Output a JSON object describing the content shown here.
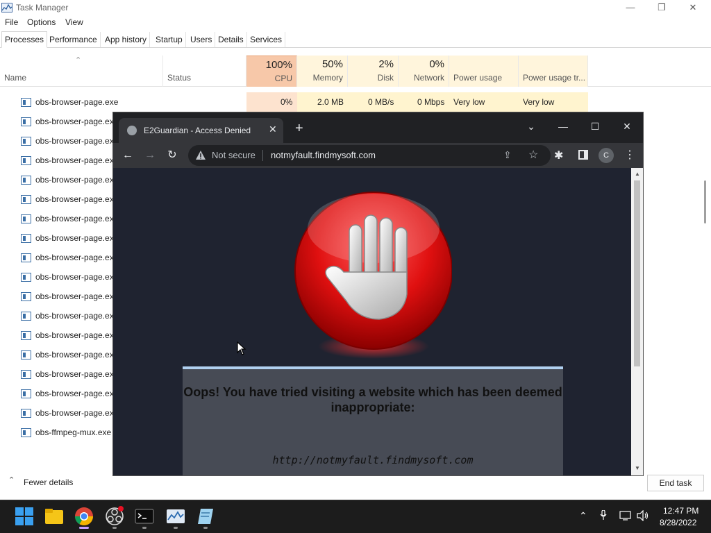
{
  "task_manager": {
    "title": "Task Manager",
    "window_controls": {
      "minimize": "—",
      "maximize": "❐",
      "close": "✕"
    },
    "menu": [
      "File",
      "Options",
      "View"
    ],
    "tabs": [
      "Processes",
      "Performance",
      "App history",
      "Startup",
      "Users",
      "Details",
      "Services"
    ],
    "active_tab": "Processes",
    "columns": {
      "name": "Name",
      "status": "Status",
      "cpu": {
        "pct": "100%",
        "label": "CPU"
      },
      "memory": {
        "pct": "50%",
        "label": "Memory"
      },
      "disk": {
        "pct": "2%",
        "label": "Disk"
      },
      "network": {
        "pct": "0%",
        "label": "Network"
      },
      "power": "Power usage",
      "power_trend": "Power usage tr..."
    },
    "first_row": {
      "name": "obs-browser-page.exe",
      "cpu": "0%",
      "memory": "2.0 MB",
      "disk": "0 MB/s",
      "network": "0 Mbps",
      "power": "Very low",
      "power_trend": "Very low"
    },
    "rows": [
      "obs-browser-page.exe",
      "obs-browser-page.exe",
      "obs-browser-page.exe",
      "obs-browser-page.exe",
      "obs-browser-page.exe",
      "obs-browser-page.exe",
      "obs-browser-page.exe",
      "obs-browser-page.exe",
      "obs-browser-page.exe",
      "obs-browser-page.exe",
      "obs-browser-page.exe",
      "obs-browser-page.exe",
      "obs-browser-page.exe",
      "obs-browser-page.exe",
      "obs-browser-page.exe",
      "obs-browser-page.exe",
      "obs-ffmpeg-mux.exe"
    ],
    "footer": {
      "fewer_details": "Fewer details",
      "end_task": "End task"
    }
  },
  "browser": {
    "tab_title": "E2Guardian - Access Denied",
    "tab_close": "✕",
    "new_tab": "+",
    "tab_search": "⌄",
    "window_controls": {
      "minimize": "—",
      "maximize": "☐",
      "close": "✕"
    },
    "nav": {
      "back": "←",
      "forward": "→",
      "reload": "↻"
    },
    "not_secure": "Not secure",
    "url": "notmyfault.findmysoft.com",
    "profile_initial": "C",
    "message": "Oops! You have tried visiting a website which has been deemed inappropriate:",
    "blocked_url": "http://notmyfault.findmysoft.com"
  },
  "taskbar": {
    "apps": [
      "start-icon",
      "file-explorer-icon",
      "chrome-icon",
      "obs-icon",
      "terminal-icon",
      "task-manager-icon",
      "notepad-icon"
    ],
    "time": "12:47 PM",
    "date": "8/28/2022"
  }
}
